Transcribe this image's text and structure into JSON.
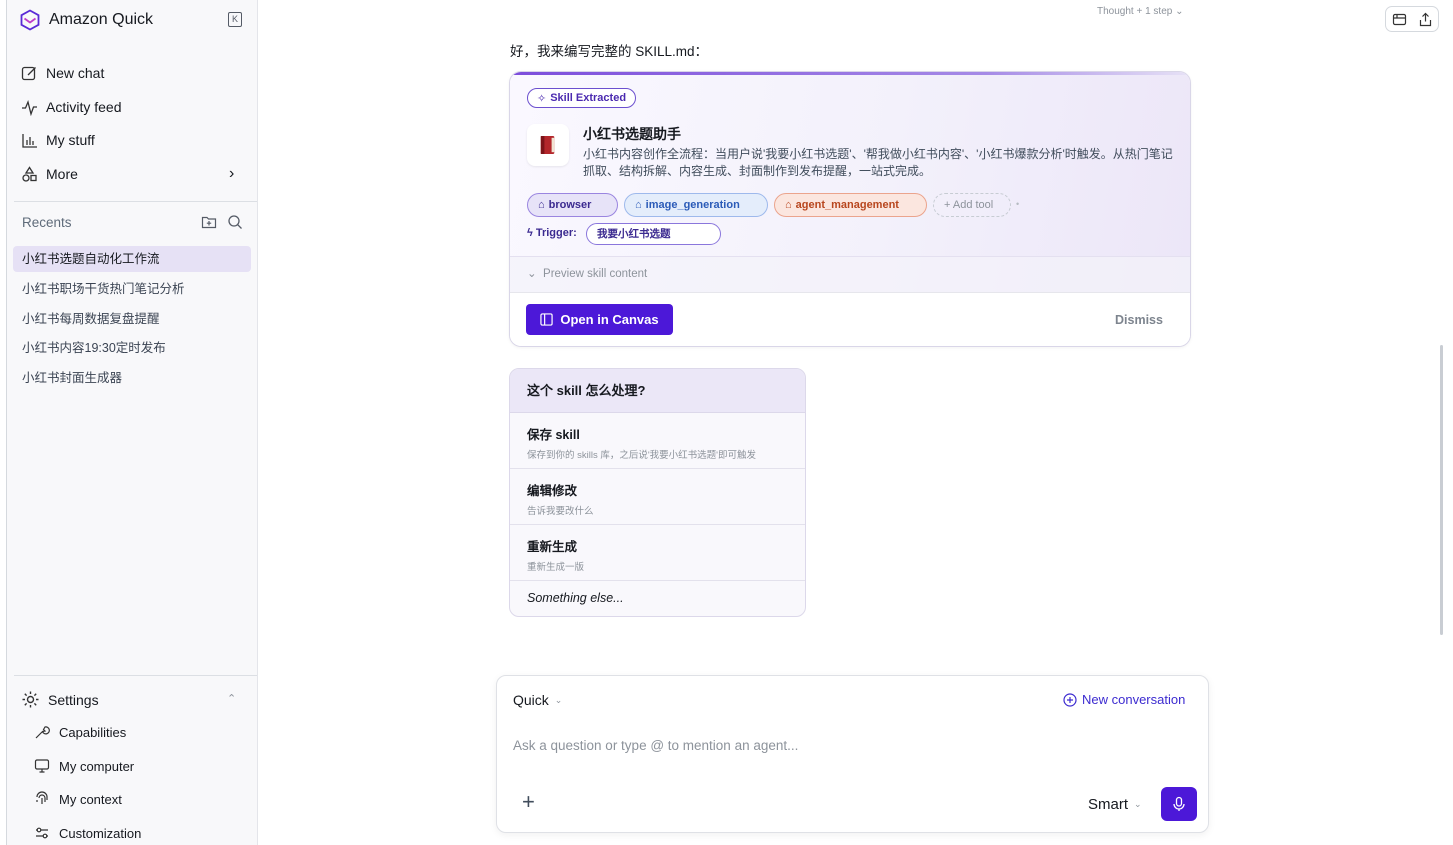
{
  "sidebar": {
    "brand": "Amazon Quick",
    "collapse_icon": "K",
    "nav": {
      "new_chat": "New chat",
      "activity_feed": "Activity feed",
      "my_stuff": "My stuff",
      "more": "More"
    },
    "recents_label": "Recents",
    "recents": [
      "小红书选题自动化工作流",
      "小红书职场干货热门笔记分析",
      "小红书每周数据复盘提醒",
      "小红书内容19:30定时发布",
      "小红书封面生成器"
    ],
    "settings": {
      "label": "Settings",
      "items": {
        "capabilities": "Capabilities",
        "my_computer": "My computer",
        "my_context": "My context",
        "customization": "Customization"
      }
    }
  },
  "top": {
    "thought": "Thought + 1 step"
  },
  "chat": {
    "message": "好，我来编写完整的 SKILL.md：",
    "skill_card": {
      "badge": "Skill Extracted",
      "title": "小红书选题助手",
      "description": "小红书内容创作全流程：当用户说'我要小红书选题'、'帮我做小红书内容'、'小红书爆款分析'时触发。从热门笔记抓取、结构拆解、内容生成、封面制作到发布提醒，一站式完成。",
      "tools": {
        "browser": "browser",
        "image_generation": "image_generation",
        "agent_management": "agent_management",
        "add_tool": "+ Add tool"
      },
      "trigger_label": "Trigger:",
      "trigger_value": "我要小红书选题",
      "preview": "Preview skill content",
      "open_canvas": "Open in Canvas",
      "dismiss": "Dismiss"
    },
    "choice": {
      "question": "这个 skill 怎么处理?",
      "options": [
        {
          "title": "保存 skill",
          "subtitle": "保存到你的 skills 库，之后说'我要小红书选题'即可触发"
        },
        {
          "title": "编辑修改",
          "subtitle": "告诉我要改什么"
        },
        {
          "title": "重新生成",
          "subtitle": "重新生成一版"
        }
      ],
      "else": "Something else..."
    }
  },
  "composer": {
    "mode": "Quick",
    "new_conversation": "New conversation",
    "placeholder": "Ask a question or type @ to mention an agent...",
    "model": "Smart"
  },
  "colors": {
    "accent": "#4c18d8",
    "sidebar_bg": "#f8f8fa",
    "active_recent": "#e6e1f5"
  }
}
